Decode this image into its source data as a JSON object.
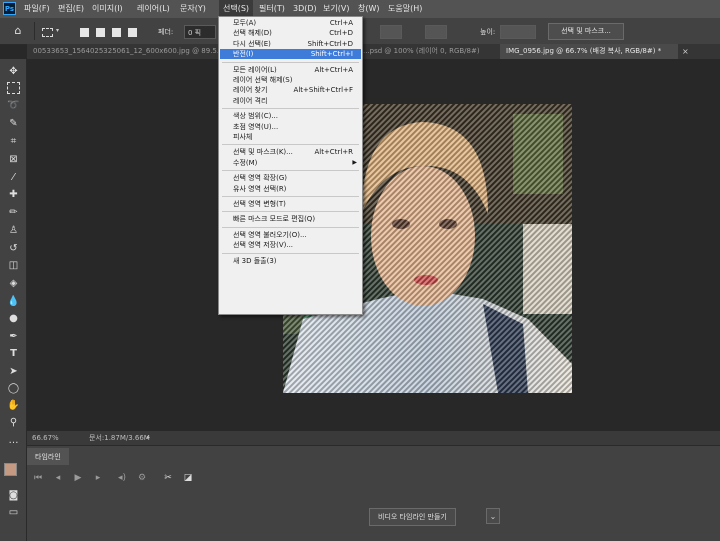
{
  "app": {
    "logo": "Ps"
  },
  "menubar": [
    {
      "id": "file",
      "label": "파일(F)"
    },
    {
      "id": "edit",
      "label": "편집(E)"
    },
    {
      "id": "image",
      "label": "이미지(I)"
    },
    {
      "id": "layer",
      "label": "레이어(L)"
    },
    {
      "id": "type",
      "label": "문자(Y)"
    },
    {
      "id": "select",
      "label": "선택(S)"
    },
    {
      "id": "filter",
      "label": "필터(T)"
    },
    {
      "id": "3d",
      "label": "3D(D)"
    },
    {
      "id": "view",
      "label": "보기(V)"
    },
    {
      "id": "window",
      "label": "창(W)"
    },
    {
      "id": "help",
      "label": "도움말(H)"
    }
  ],
  "options_bar": {
    "feather_label": "페더:",
    "feather_value": "0 픽",
    "height_label": "높이:",
    "select_mask_button": "선택 및 마스크..."
  },
  "tabs": [
    {
      "label": "00533653_1564025325061_12_600x600.jpg @ 89.5...",
      "active": false
    },
    {
      "label": "...psd @ 100% (레이어 0, RGB/8#)",
      "active": false
    },
    {
      "label": "IMG_0956.jpg @ 66.7% (배경 복사, RGB/8#) *",
      "active": true
    }
  ],
  "select_menu": {
    "items": [
      {
        "label": "모두(A)",
        "shortcut": "Ctrl+A"
      },
      {
        "label": "선택 해제(D)",
        "shortcut": "Ctrl+D"
      },
      {
        "label": "다시 선택(E)",
        "shortcut": "Shift+Ctrl+D"
      },
      {
        "label": "반전(I)",
        "shortcut": "Shift+Ctrl+I",
        "highlighted": true
      },
      {
        "sep": true
      },
      {
        "label": "모든 레이어(L)",
        "shortcut": "Alt+Ctrl+A"
      },
      {
        "label": "레이어 선택 해제(S)",
        "shortcut": ""
      },
      {
        "label": "레이어 찾기",
        "shortcut": "Alt+Shift+Ctrl+F"
      },
      {
        "label": "레이어 격리",
        "shortcut": ""
      },
      {
        "sep": true
      },
      {
        "label": "색상 범위(C)...",
        "shortcut": ""
      },
      {
        "label": "초점 영역(U)...",
        "shortcut": ""
      },
      {
        "label": "피사체",
        "shortcut": ""
      },
      {
        "sep": true
      },
      {
        "label": "선택 및 마스크(K)...",
        "shortcut": "Alt+Ctrl+R"
      },
      {
        "label": "수정(M)",
        "shortcut": "",
        "submenu": true
      },
      {
        "sep": true
      },
      {
        "label": "선택 영역 확장(G)",
        "shortcut": ""
      },
      {
        "label": "유사 영역 선택(R)",
        "shortcut": ""
      },
      {
        "sep": true
      },
      {
        "label": "선택 영역 변형(T)",
        "shortcut": ""
      },
      {
        "sep": true
      },
      {
        "label": "빠른 마스크 모드로 편집(Q)",
        "shortcut": ""
      },
      {
        "sep": true
      },
      {
        "label": "선택 영역 불러오기(O)...",
        "shortcut": ""
      },
      {
        "label": "선택 영역 저장(V)...",
        "shortcut": ""
      },
      {
        "sep": true
      },
      {
        "label": "새 3D 돌출(3)",
        "shortcut": ""
      }
    ]
  },
  "status": {
    "zoom": "66.67%",
    "doc_size": "문서:1.87M/3.66M"
  },
  "timeline": {
    "panel_tab": "타임라인",
    "create_button": "비디오 타임라인 만들기"
  },
  "colors": {
    "foreground": "#c49a82",
    "background": "#ffffff",
    "highlight": "#3f7bd9"
  }
}
